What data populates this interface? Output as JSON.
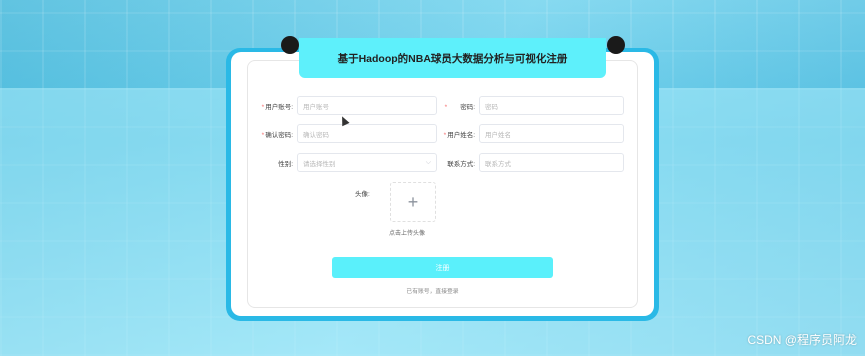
{
  "title": "基于Hadoop的NBA球员大数据分析与可视化注册",
  "form": {
    "account": {
      "label": "用户账号:",
      "placeholder": "用户账号",
      "required": true
    },
    "password": {
      "label": "密码:",
      "placeholder": "密码",
      "required": true
    },
    "confirm_password": {
      "label": "确认密码:",
      "placeholder": "确认密码",
      "required": true
    },
    "name": {
      "label": "用户姓名:",
      "placeholder": "用户姓名",
      "required": true
    },
    "gender": {
      "label": "性别:",
      "placeholder": "请选择性别",
      "options": []
    },
    "contact": {
      "label": "联系方式:",
      "placeholder": "联系方式"
    },
    "avatar": {
      "label": "头像:",
      "hint": "点击上传头像",
      "icon": "plus-icon"
    }
  },
  "register_button": "注册",
  "login_link": "已有账号，直接登录",
  "required_mark": "*",
  "watermark": "CSDN @程序员阿龙",
  "colors": {
    "accent": "#5ef0fb",
    "required": "#f56c6c"
  }
}
